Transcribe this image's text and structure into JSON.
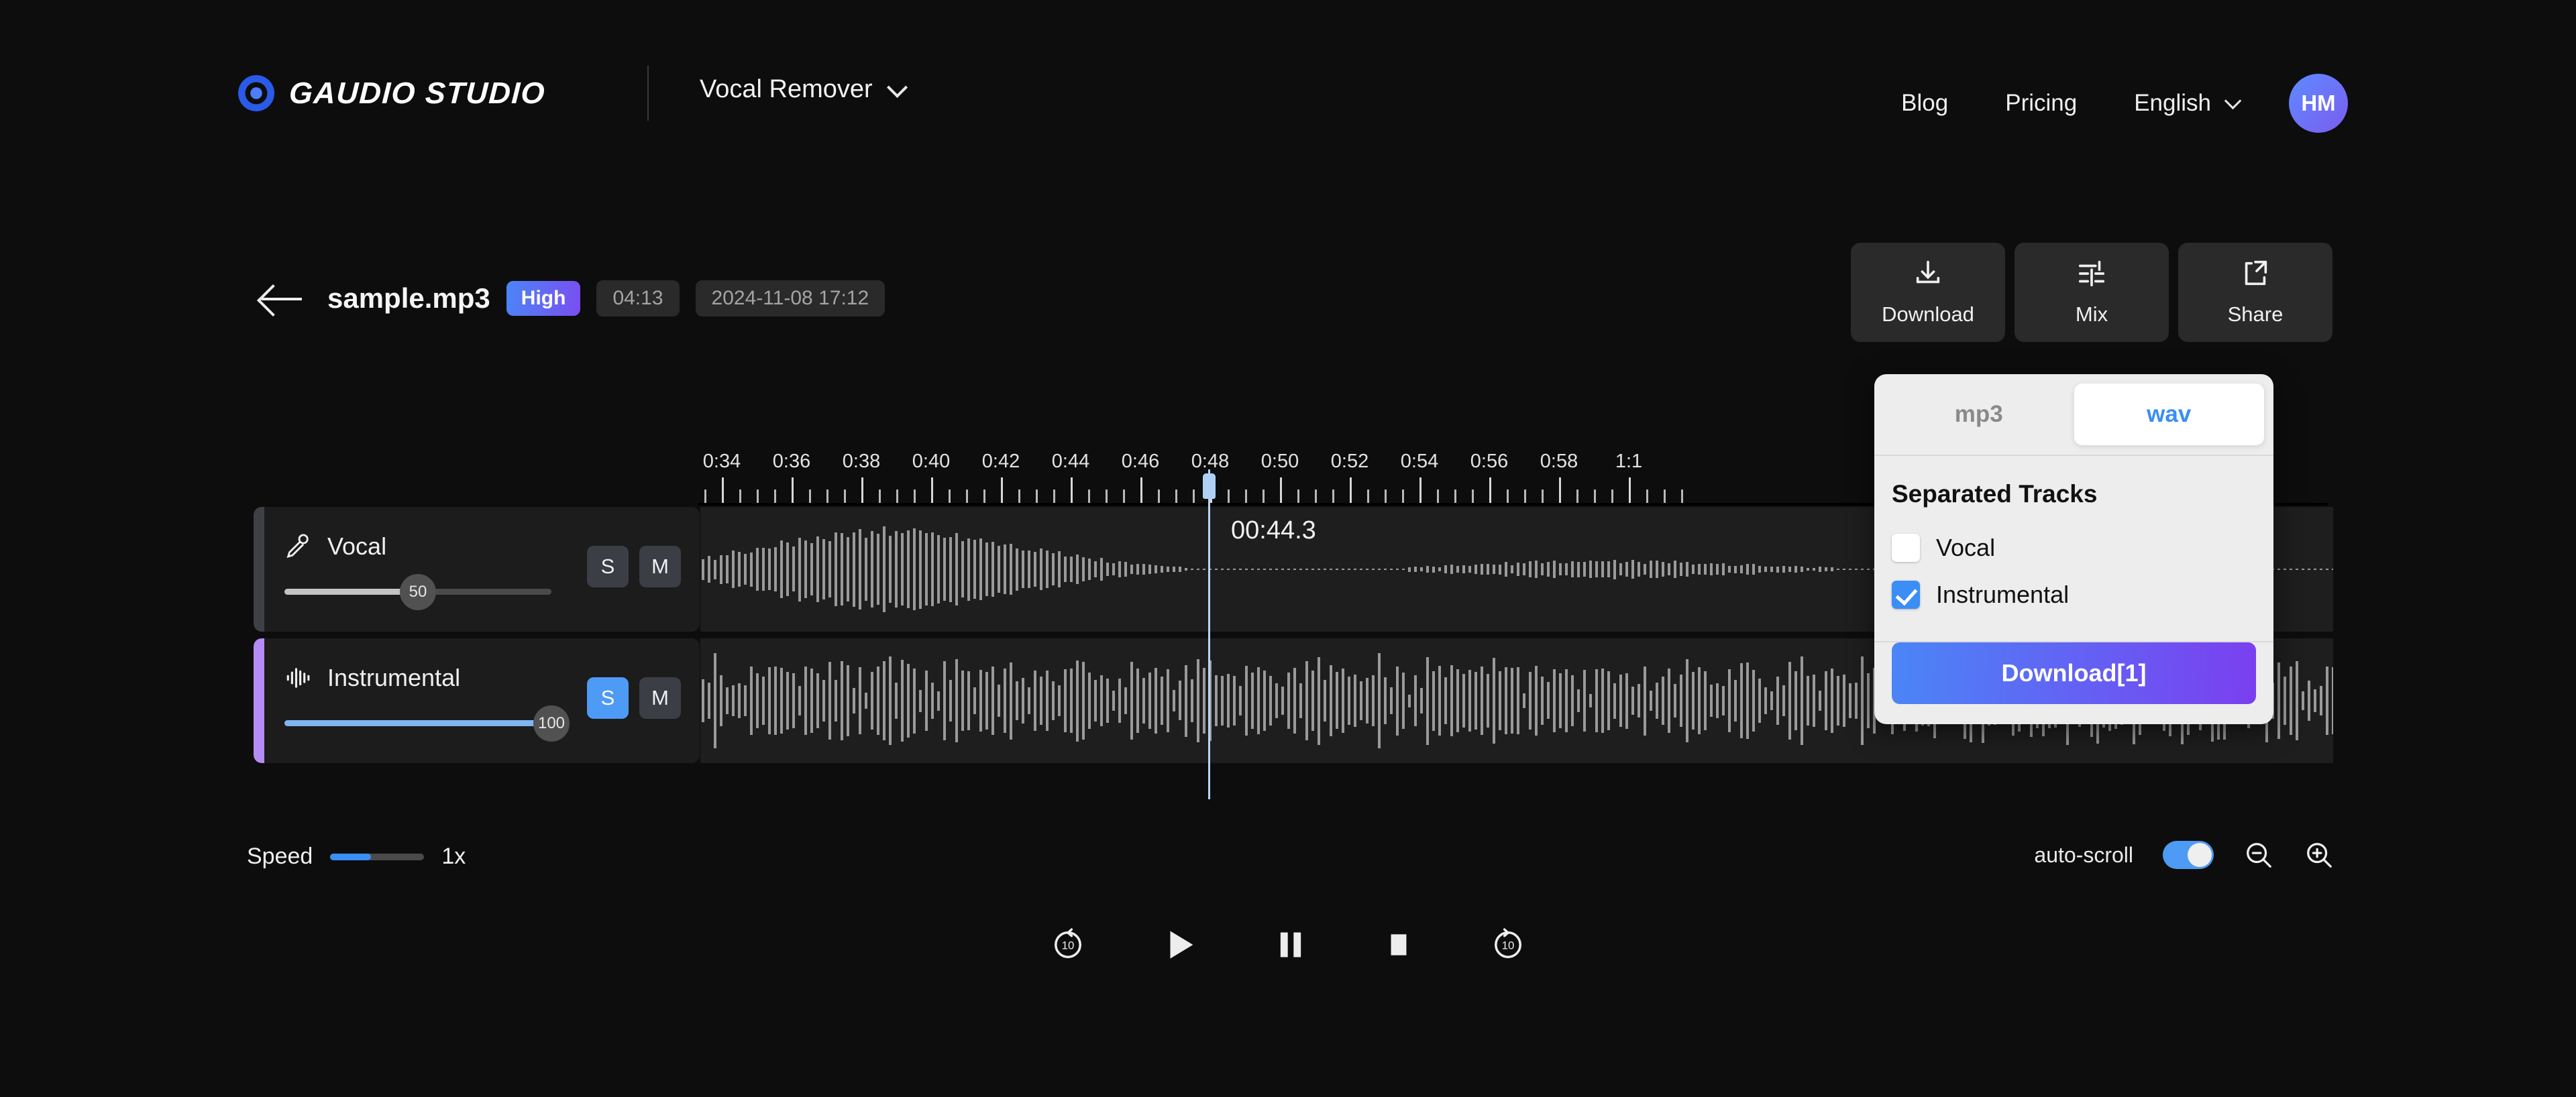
{
  "header": {
    "brand": "GAUDIO STUDIO",
    "mode": "Vocal Remover",
    "nav": [
      {
        "label": "Blog"
      },
      {
        "label": "Pricing"
      }
    ],
    "language": "English",
    "avatar_initials": "HM"
  },
  "file": {
    "name": "sample.mp3",
    "quality_badge": "High",
    "duration": "04:13",
    "created_at": "2024-11-08 17:12"
  },
  "actions": [
    {
      "label": "Download",
      "icon": "download-icon"
    },
    {
      "label": "Mix",
      "icon": "mixer-icon"
    },
    {
      "label": "Share",
      "icon": "share-icon"
    }
  ],
  "download_panel": {
    "formats": [
      {
        "label": "mp3",
        "active": false
      },
      {
        "label": "wav",
        "active": true
      }
    ],
    "section_title": "Separated Tracks",
    "tracks": [
      {
        "label": "Vocal",
        "checked": false
      },
      {
        "label": "Instrumental",
        "checked": true
      }
    ],
    "download_button": "Download[1]",
    "accent_color": "#3a8ef6"
  },
  "timeline": {
    "labels": [
      "0:34",
      "0:36",
      "0:38",
      "0:40",
      "0:42",
      "0:44",
      "0:46",
      "0:48",
      "0:50",
      "0:52",
      "0:54",
      "0:56",
      "0:58",
      "1:1"
    ],
    "playhead_time": "00:44.3"
  },
  "tracks": [
    {
      "name": "Vocal",
      "icon": "microphone-icon",
      "volume": 50,
      "solo": false,
      "mute": false,
      "solo_label": "S",
      "mute_label": "M",
      "accent_color": "#3e4046",
      "fill_color": "#c3c3c3"
    },
    {
      "name": "Instrumental",
      "icon": "waveform-icon",
      "volume": 100,
      "solo": true,
      "mute": false,
      "solo_label": "S",
      "mute_label": "M",
      "accent_color": "#b58cf5",
      "fill_color": "#7fb4f2"
    }
  ],
  "bottom": {
    "speed_label": "Speed",
    "speed_value": "1x",
    "autoscroll_label": "auto-scroll",
    "autoscroll_on": true,
    "zoom_out_icon": "zoom-out-icon",
    "zoom_in_icon": "zoom-in-icon"
  },
  "transport": [
    {
      "name": "rewind-10-icon",
      "label": "10"
    },
    {
      "name": "play-icon",
      "label": ""
    },
    {
      "name": "pause-icon",
      "label": ""
    },
    {
      "name": "stop-icon",
      "label": ""
    },
    {
      "name": "forward-10-icon",
      "label": "10"
    }
  ]
}
